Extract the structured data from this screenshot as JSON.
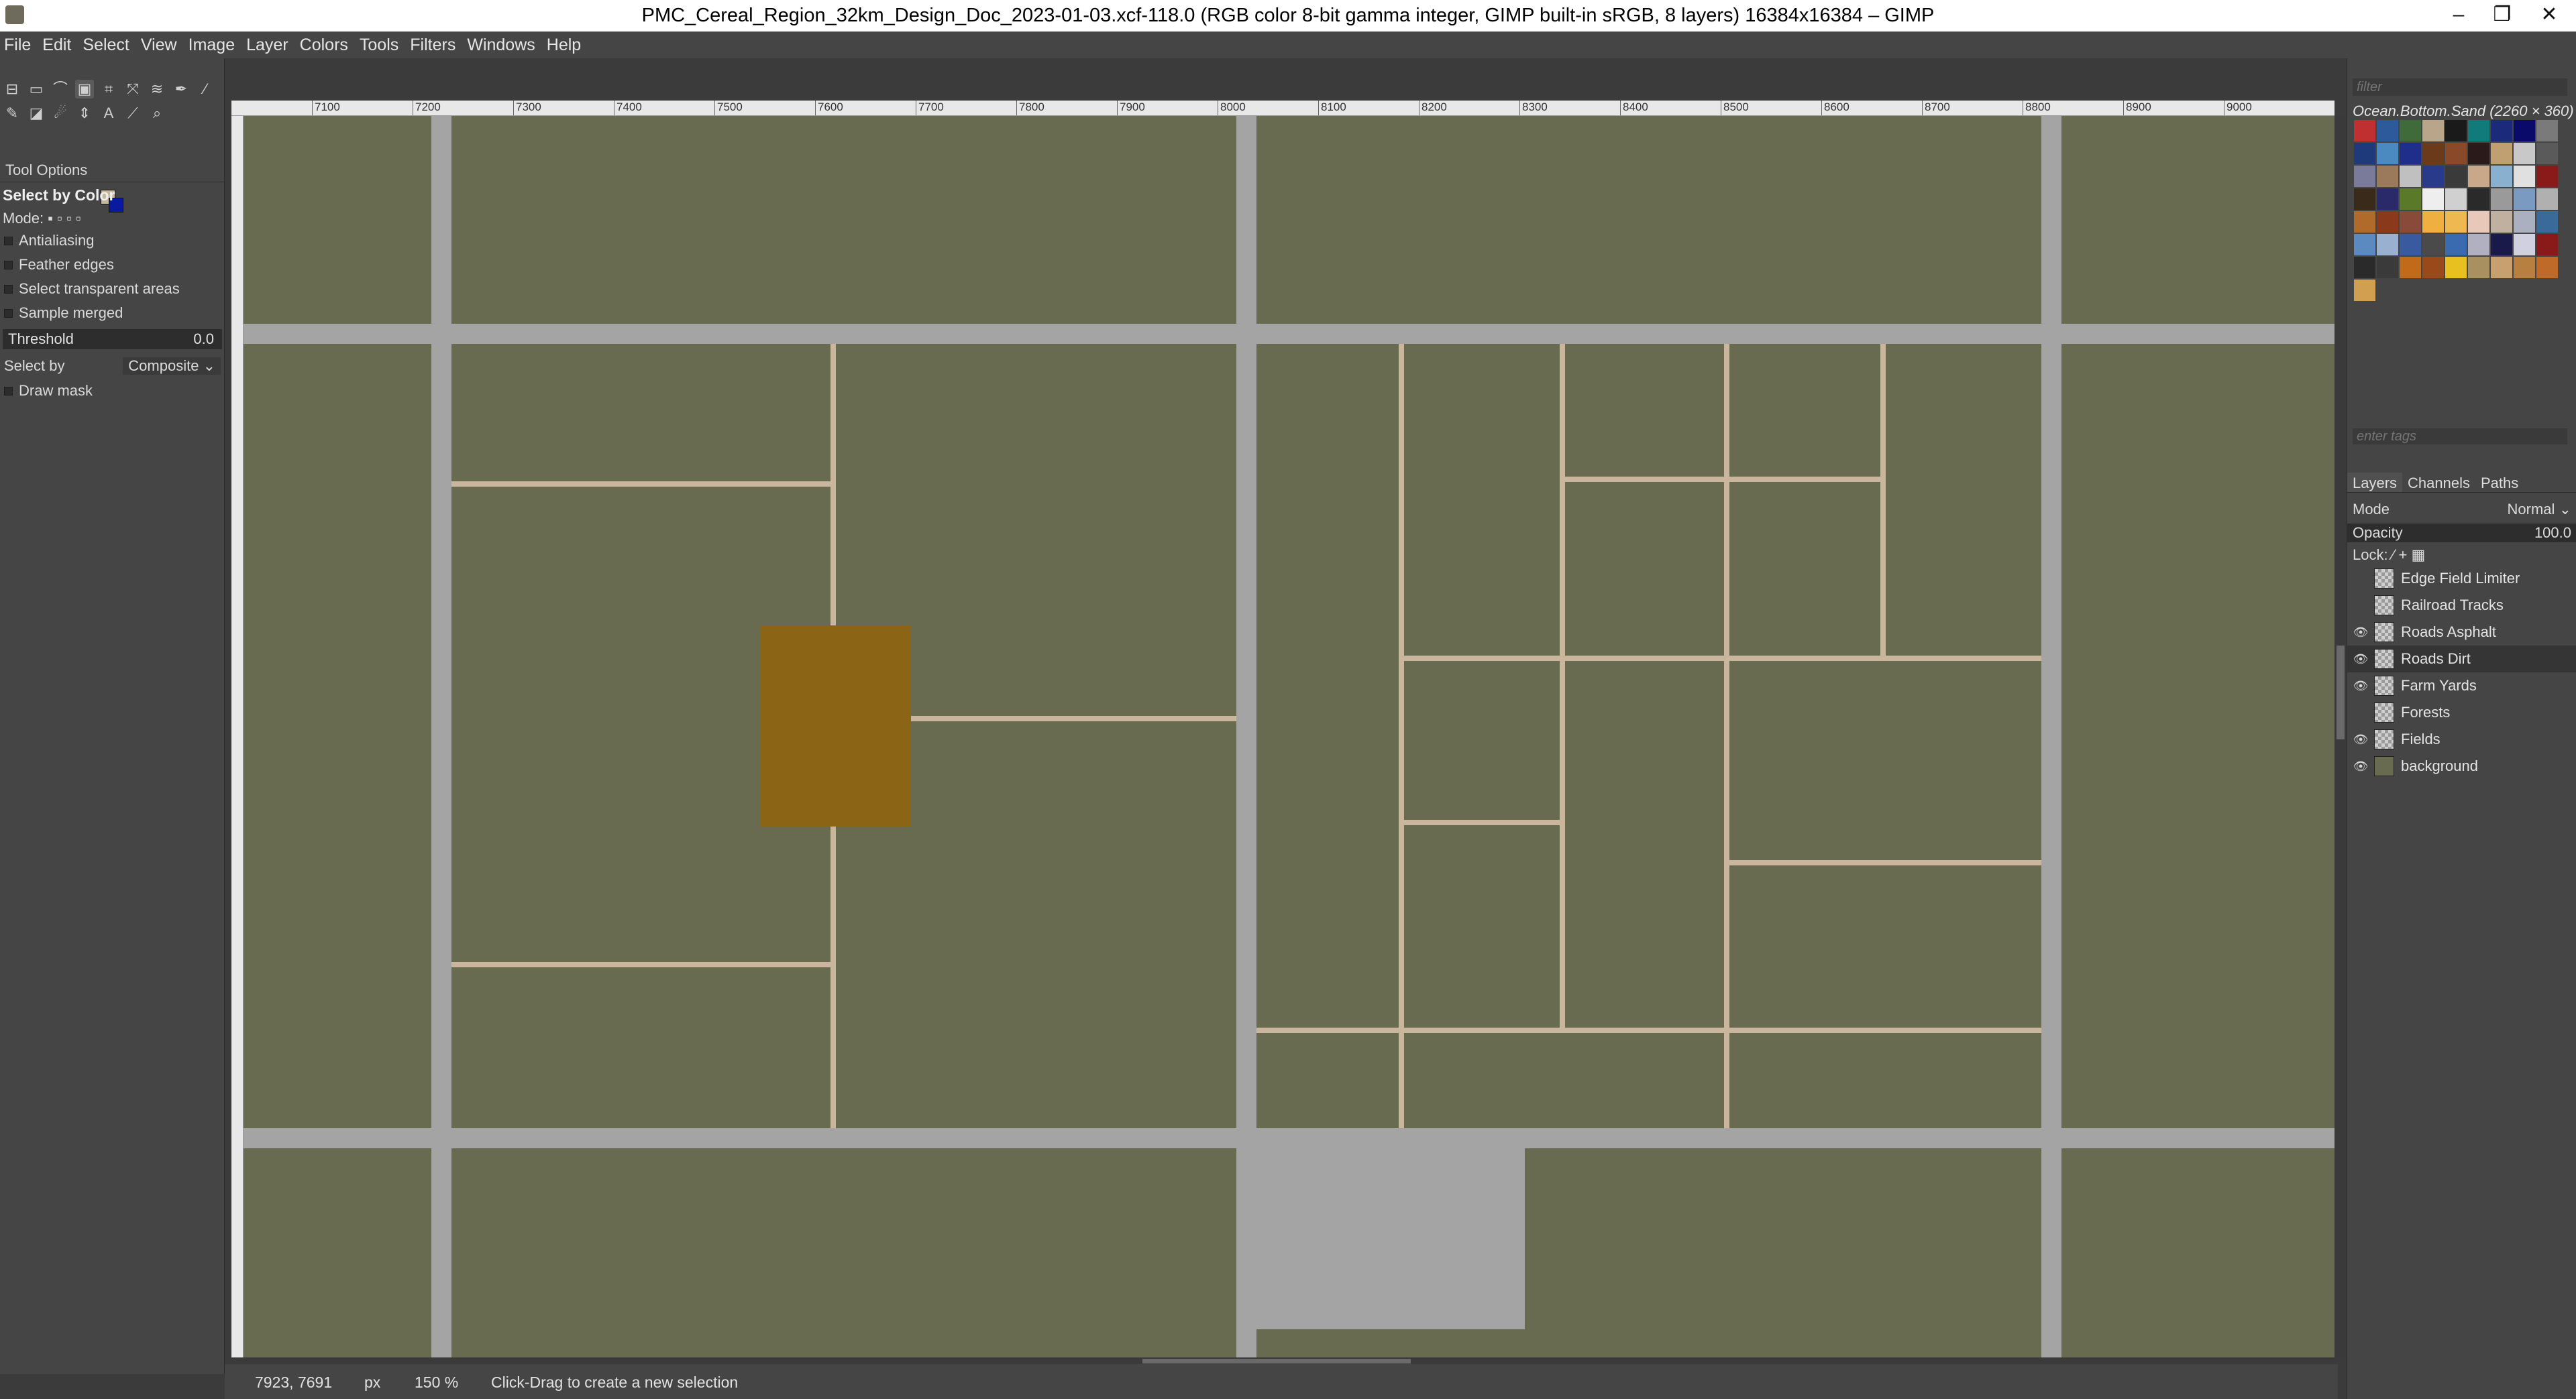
{
  "window": {
    "title": "PMC_Cereal_Region_32km_Design_Doc_2023-01-03.xcf-118.0 (RGB color 8-bit gamma integer, GIMP built-in sRGB, 8 layers) 16384x16384 – GIMP",
    "minimize": "–",
    "maximize": "❐",
    "close": "✕"
  },
  "menu": [
    "File",
    "Edit",
    "Select",
    "View",
    "Image",
    "Layer",
    "Colors",
    "Tools",
    "Filters",
    "Windows",
    "Help"
  ],
  "tool_options": {
    "tab_label": "Tool Options",
    "tool_name": "Select by Color",
    "mode_label": "Mode:",
    "antialiasing": "Antialiasing",
    "feather": "Feather edges",
    "transparent": "Select transparent areas",
    "sample_merged": "Sample merged",
    "threshold_label": "Threshold",
    "threshold_value": "0.0",
    "select_by_label": "Select by",
    "select_by_value": "Composite",
    "draw_mask": "Draw mask"
  },
  "ruler": [
    "7100",
    "7200",
    "7300",
    "7400",
    "7500",
    "7600",
    "7700",
    "7800",
    "7900",
    "8000",
    "8100",
    "8200",
    "8300",
    "8400",
    "8500",
    "8600",
    "8700",
    "8800",
    "8900",
    "9000"
  ],
  "status": {
    "coords": "7923, 7691",
    "unit": "px",
    "zoom": "150 %",
    "message": "Click-Drag to create a new selection"
  },
  "patterns": {
    "filter_placeholder": "filter",
    "selected_name": "Ocean.Bottom.Sand (2260 × 360)",
    "tags_placeholder": "enter tags",
    "swatch_colors": [
      "#c03030",
      "#2d5a9a",
      "#3f6a3a",
      "#b8a58a",
      "#1a1a1a",
      "#117a7a",
      "#1b2a7a",
      "#0a0a6a",
      "#7a7a7a",
      "#1e3a7a",
      "#4a8ac0",
      "#1e2e8a",
      "#6a3a1a",
      "#8a4a2a",
      "#2a1a1a",
      "#c0a070",
      "#c8c8c8",
      "#5a5a5a",
      "#7a7a9a",
      "#9a7a5a",
      "#c0c0c0",
      "#2a3a8a",
      "#3a3a3a",
      "#c8a888",
      "#8ab0d0",
      "#e0e0e0",
      "#8a1a1a",
      "#3a2a1a",
      "#2a2a6a",
      "#5a7a2a",
      "#eeeeee",
      "#d0d0d0",
      "#2a2a2a",
      "#9a9a9a",
      "#7a9ac0",
      "#b0b0b0",
      "#b06a2a",
      "#8a3a1a",
      "#8a4a3a",
      "#f0b040",
      "#f0b850",
      "#e8c8b8",
      "#c0b0a0",
      "#aab0c0",
      "#3a6a9a",
      "#5a8ac0",
      "#9ab0d0",
      "#3a5aa0",
      "#4a4a4a",
      "#3a6ab0",
      "#b0b0c0",
      "#1a1a4a",
      "#d0d0e0",
      "#8a1a1a",
      "#2a2a2a",
      "#3a3a3a",
      "#c06a1a",
      "#9a4a1a",
      "#e8c020",
      "#a89060",
      "#c8a070",
      "#b88040",
      "#c06a2a",
      "#d0a050"
    ]
  },
  "layers_panel": {
    "tabs": [
      "Layers",
      "Channels",
      "Paths"
    ],
    "mode_label": "Mode",
    "mode_value": "Normal",
    "opacity_label": "Opacity",
    "opacity_value": "100.0",
    "lock_label": "Lock:",
    "layers": [
      {
        "name": "Edge Field Limiter",
        "visible": false,
        "selected": false
      },
      {
        "name": "Railroad Tracks",
        "visible": false,
        "selected": false
      },
      {
        "name": "Roads Asphalt",
        "visible": true,
        "selected": false
      },
      {
        "name": "Roads Dirt",
        "visible": true,
        "selected": true
      },
      {
        "name": "Farm Yards",
        "visible": true,
        "selected": false
      },
      {
        "name": "Forests",
        "visible": false,
        "selected": false
      },
      {
        "name": "Fields",
        "visible": true,
        "selected": false
      },
      {
        "name": "background",
        "visible": true,
        "selected": false
      }
    ]
  }
}
